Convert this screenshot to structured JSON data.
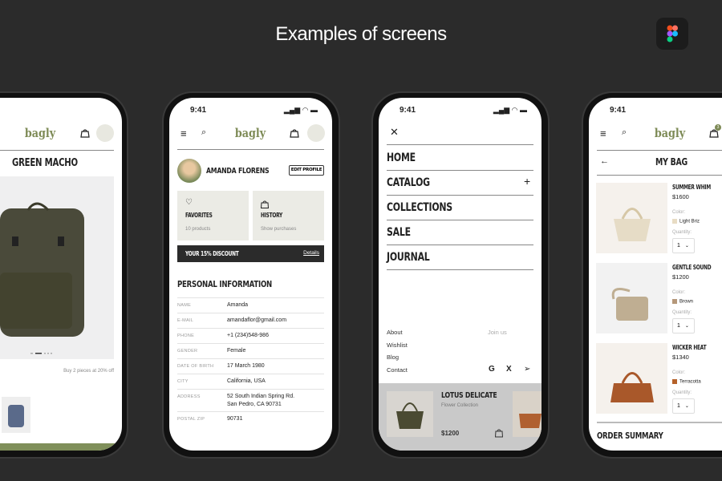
{
  "header": {
    "title": "Examples of screens",
    "figma_icon": "figma-logo-icon"
  },
  "brand": {
    "logo": "bagly",
    "accent": "#7d8a55"
  },
  "status": {
    "time": "9:41"
  },
  "product_screen": {
    "title": "GREEN MACHO",
    "promo": "Buy 2 pieces at 20% off",
    "carousel_active": 2,
    "carousel_count": 5
  },
  "profile_screen": {
    "name": "AMANDA FLORENS",
    "edit_label": "EDIT PROFILE",
    "cards": [
      {
        "icon": "heart-icon",
        "title": "FAVORITES",
        "sub": "10 products"
      },
      {
        "icon": "bag-icon",
        "title": "HISTORY",
        "sub": "Show purchases"
      }
    ],
    "discount": {
      "label": "YOUR 15% DISCOUNT",
      "link": "Details"
    },
    "section_title": "PERSONAL INFORMATION",
    "rows": [
      {
        "label": "NAME",
        "value": "Amanda"
      },
      {
        "label": "E-MAIL",
        "value": "amandaflor@gmail.com"
      },
      {
        "label": "PHONE",
        "value": "+1 (234)548-986"
      },
      {
        "label": "GENDER",
        "value": "Female"
      },
      {
        "label": "DATE OF BIRTH",
        "value": "17 March 1980"
      },
      {
        "label": "CITY",
        "value": "California, USA"
      },
      {
        "label": "ADDRESS",
        "value": "52 South Indian Spring Rd.",
        "value2": "San Pedro, CA 90731"
      },
      {
        "label": "POSTAL ZIP",
        "value": "90731"
      }
    ]
  },
  "menu_screen": {
    "items": [
      "HOME",
      "CATALOG",
      "COLLECTIONS",
      "SALE",
      "JOURNAL"
    ],
    "footer_links": [
      "About",
      "Wishlist",
      "Blog",
      "Contact"
    ],
    "join": "Join us",
    "social": [
      "google-icon",
      "x-icon",
      "telegram-icon"
    ],
    "card": {
      "name": "LOTUS DELICATE",
      "collection": "Flower Collection",
      "price": "$1200"
    }
  },
  "bag_screen": {
    "title": "MY BAG",
    "badge": "3",
    "color_label": "Color:",
    "quantity_label": "Quantity:",
    "items": [
      {
        "name": "SUMMER WHIM",
        "price": "$1600",
        "color": "Light Briz",
        "swatch": "#e8dcc4",
        "qty": "1"
      },
      {
        "name": "GENTLE SOUND",
        "price": "$1200",
        "color": "Brown",
        "swatch": "#b5987a",
        "qty": "1"
      },
      {
        "name": "WICKER HEAT",
        "price": "$1340",
        "color": "Terracotta",
        "swatch": "#b5622a",
        "qty": "1"
      }
    ],
    "summary": "ORDER SUMMARY"
  }
}
